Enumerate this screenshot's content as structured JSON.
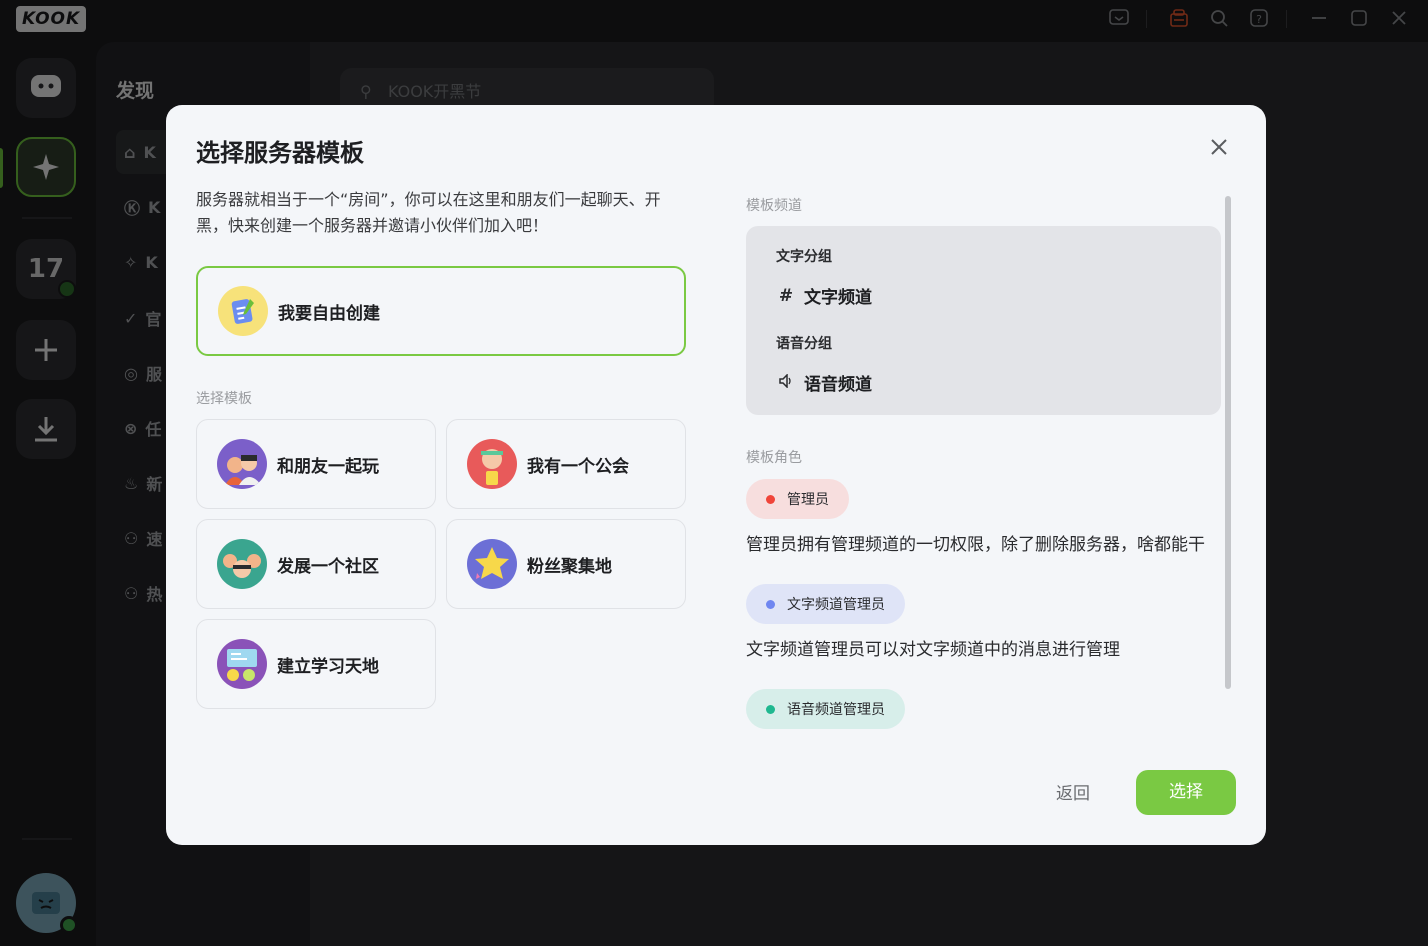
{
  "app": {
    "logo": "KOOK"
  },
  "topbar": {
    "icons": [
      "inbox-icon",
      "gift-icon",
      "search-icon",
      "help-icon",
      "minimize-icon",
      "maximize-icon",
      "close-icon"
    ]
  },
  "rail": {
    "badge_number": "17"
  },
  "sidebar": {
    "title": "发现",
    "items": [
      {
        "label": "K",
        "icon": "gamepad-icon"
      },
      {
        "label": "K",
        "icon": "k-icon"
      },
      {
        "label": "K",
        "icon": "party-icon"
      },
      {
        "label": "官",
        "icon": "verified-icon"
      },
      {
        "label": "服",
        "icon": "planet-icon"
      },
      {
        "label": "任",
        "icon": "task-icon"
      },
      {
        "label": "新",
        "icon": "flame-icon"
      },
      {
        "label": "速",
        "icon": "user-group-icon"
      },
      {
        "label": "热",
        "icon": "user-group-icon"
      }
    ]
  },
  "main": {
    "search_placeholder": "KOOK开黑节"
  },
  "modal": {
    "title": "选择服务器模板",
    "intro": "服务器就相当于一个“房间”，你可以在这里和朋友们一起聊天、开黑，快来创建一个服务器并邀请小伙伴们加入吧！",
    "create_label": "我要自由创建",
    "templates_label": "选择模板",
    "templates": [
      {
        "label": "和朋友一起玩",
        "color": "#7b5fc9"
      },
      {
        "label": "我有一个公会",
        "color": "#e85a5a"
      },
      {
        "label": "发展一个社区",
        "color": "#3aa58f"
      },
      {
        "label": "粉丝聚集地",
        "color": "#6c6fd6"
      },
      {
        "label": "建立学习天地",
        "color": "#8a52b8"
      }
    ],
    "preview": {
      "channels_label": "模板频道",
      "text_group": "文字分组",
      "text_channel": "文字频道",
      "voice_group": "语音分组",
      "voice_channel": "语音频道",
      "roles_label": "模板角色",
      "roles": [
        {
          "name": "管理员",
          "desc": "管理员拥有管理频道的一切权限，除了删除服务器，啥都能干",
          "dot": "#f0453a",
          "bg": "#f7dede"
        },
        {
          "name": "文字频道管理员",
          "desc": "文字频道管理员可以对文字频道中的消息进行管理",
          "dot": "#6f86f0",
          "bg": "#dfe4f7"
        },
        {
          "name": "语音频道管理员",
          "desc": "",
          "dot": "#1fb890",
          "bg": "#d7eeea"
        }
      ]
    },
    "back_label": "返回",
    "select_label": "选择"
  }
}
